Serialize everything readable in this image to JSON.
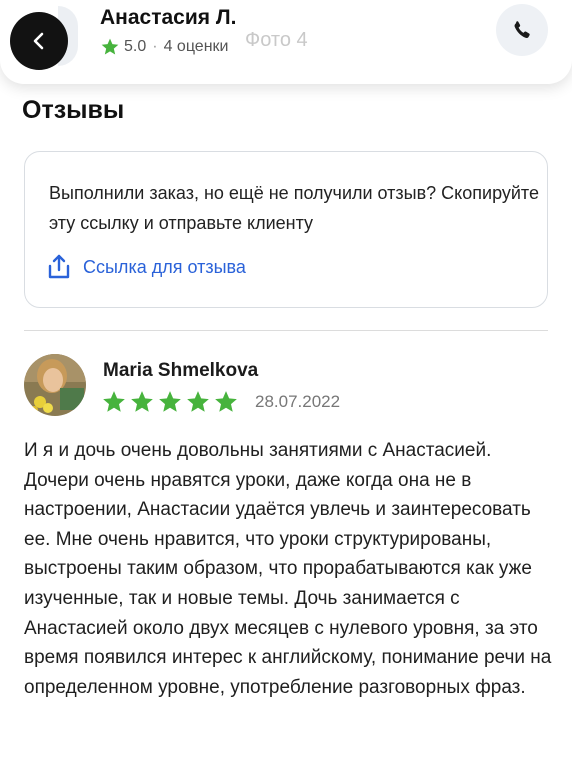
{
  "header": {
    "name": "Анастасия Л.",
    "rating": "5.0",
    "separator": "·",
    "reviews_count": "4 оценки",
    "photo_overlay": "Фото 4",
    "back_icon": "chevron-left-icon",
    "phone_icon": "phone-icon"
  },
  "reviews_section": {
    "title": "Отзывы"
  },
  "info_card": {
    "text": "Выполнили заказ, но ещё не получили отзыв? Скопируйте эту ссылку и отправьте клиенту",
    "link_label": "Ссылка для отзыва",
    "link_icon": "share-icon"
  },
  "review": {
    "author": "Maria Shmelkova",
    "rating": 5,
    "date": "28.07.2022",
    "text": "И я и дочь очень довольны занятиями с Анастасией. Дочери очень нравятся уроки, даже когда она не в настроении, Анастасии удаётся увлечь и заинтересовать ее. Мне очень нравится, что уроки структурированы, выстроены таким образом, что прорабатываются как уже изученные, так и новые темы. Дочь занимается с Анастасией около двух месяцев с нулевого уровня, за это время появился интерес к английскому, понимание речи на определенном уровне, употребление разговорных фраз."
  },
  "colors": {
    "accent_link": "#2a62d9",
    "star": "#47b33d",
    "back_button": "#121212"
  }
}
